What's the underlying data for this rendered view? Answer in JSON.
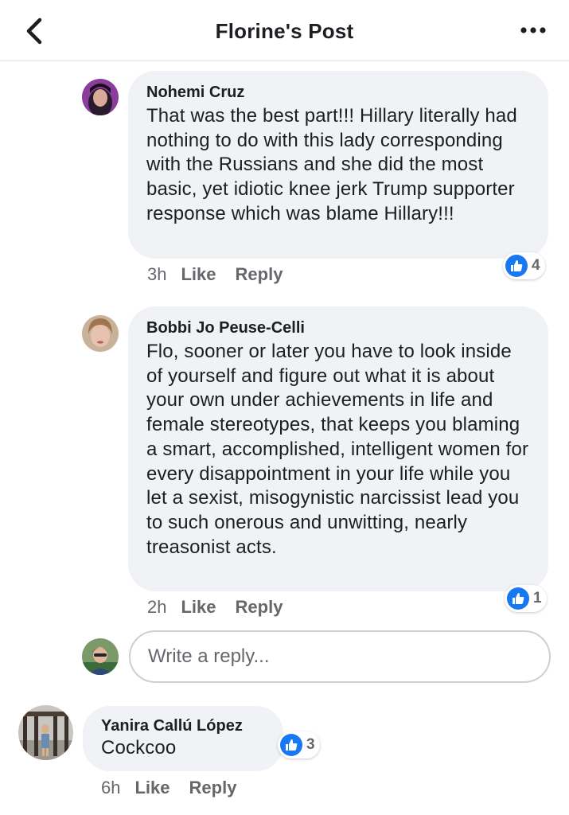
{
  "header": {
    "title": "Florine's Post",
    "back_icon": "chevron-left-icon",
    "more_icon": "more-dots-icon"
  },
  "comments": [
    {
      "author": "Nohemi Cruz",
      "text": "That was the best part!!! Hillary literally had nothing to do with this lady corresponding with the Russians and she did the most basic, yet idiotic knee jerk Trump supporter response which was blame Hillary!!!",
      "time": "3h",
      "like_label": "Like",
      "reply_label": "Reply",
      "reaction_count": "4"
    },
    {
      "author": "Bobbi Jo Peuse-Celli",
      "text": "Flo, sooner or later you have to look inside of yourself and figure out what it is about your own under achievements in life and female stereotypes, that keeps you blaming a smart, accomplished, intelligent women for every disappointment in your life while you let a sexist, misogynistic narcissist lead you to such onerous and unwitting, nearly treasonist acts.",
      "time": "2h",
      "like_label": "Like",
      "reply_label": "Reply",
      "reaction_count": "1"
    },
    {
      "author": "Yanira Callú López",
      "text": "Cockcoo",
      "time": "6h",
      "like_label": "Like",
      "reply_label": "Reply",
      "reaction_count": "3"
    }
  ],
  "reply_box": {
    "placeholder": "Write a reply..."
  },
  "colors": {
    "like_blue": "#1877f2",
    "bubble_bg": "#f0f2f5",
    "meta_gray": "#65676b"
  }
}
